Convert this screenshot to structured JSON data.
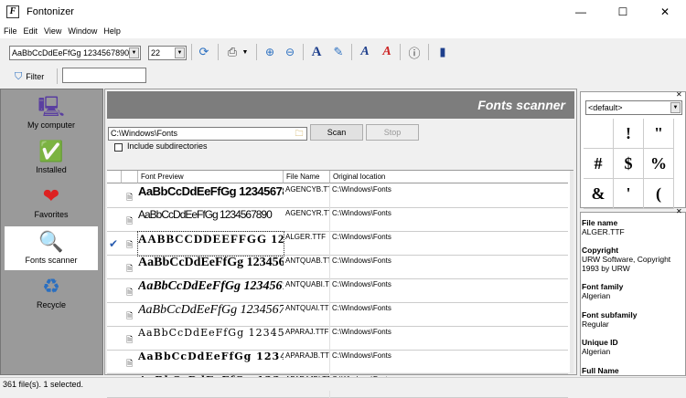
{
  "window": {
    "title": "Fontonizer",
    "minimize_glyph": "—",
    "maximize_glyph": "☐",
    "close_glyph": "✕"
  },
  "menu": [
    "File",
    "Edit",
    "View",
    "Window",
    "Help"
  ],
  "toolbar": {
    "sample_text": "AaBbCcDdEeFfGg 1234567890",
    "font_size": "22",
    "icons": [
      "refresh-icon",
      "print-icon",
      "zoom-in-icon",
      "zoom-out-icon",
      "font-style-icon",
      "pen-icon",
      "install-font-icon",
      "uninstall-font-icon",
      "help-icon",
      "exit-icon"
    ]
  },
  "filter": {
    "label": "Filter",
    "value": ""
  },
  "sidebar": {
    "items": [
      {
        "label": "My computer"
      },
      {
        "label": "Installed"
      },
      {
        "label": "Favorites"
      },
      {
        "label": "Fonts scanner"
      },
      {
        "label": "Recycle"
      }
    ]
  },
  "main": {
    "header": "Fonts scanner",
    "path": "C:\\Windows\\Fonts",
    "scan_label": "Scan",
    "stop_label": "Stop",
    "subdirs_label": "Include subdirectories"
  },
  "table": {
    "columns": [
      "Font Preview",
      "File Name",
      "Original location"
    ],
    "rows": [
      {
        "file": "AGENCYB.TTF",
        "location": "C:\\Windows\\Fonts",
        "selected": false
      },
      {
        "file": "AGENCYR.TTF",
        "location": "C:\\Windows\\Fonts",
        "selected": false
      },
      {
        "file": "ALGER.TTF",
        "location": "C:\\Windows\\Fonts",
        "selected": true
      },
      {
        "file": "ANTQUAB.TTF",
        "location": "C:\\Windows\\Fonts",
        "selected": false
      },
      {
        "file": "ANTQUABI.TTF",
        "location": "C:\\Windows\\Fonts",
        "selected": false
      },
      {
        "file": "ANTQUAI.TTF",
        "location": "C:\\Windows\\Fonts",
        "selected": false
      },
      {
        "file": "APARAJ.TTF",
        "location": "C:\\Windows\\Fonts",
        "selected": false
      },
      {
        "file": "APARAJB.TTF",
        "location": "C:\\Windows\\Fonts",
        "selected": false
      },
      {
        "file": "APARAJBI.TTF",
        "location": "C:\\Windows\\Fonts",
        "selected": false
      }
    ]
  },
  "charmap": {
    "font": "<default>",
    "glyphs": [
      "",
      "!",
      "\"",
      "#",
      "$",
      "%",
      "&",
      "'",
      "("
    ]
  },
  "properties": [
    {
      "label": "File name",
      "value": "ALGER.TTF"
    },
    {
      "label": "Copyright",
      "value": "URW Software, Copyright 1993 by URW"
    },
    {
      "label": "Font family",
      "value": "Algerian"
    },
    {
      "label": "Font subfamily",
      "value": "Regular"
    },
    {
      "label": "Unique ID",
      "value": "Algerian"
    },
    {
      "label": "Full Name",
      "value": ""
    }
  ],
  "status": "361 file(s). 1 selected."
}
